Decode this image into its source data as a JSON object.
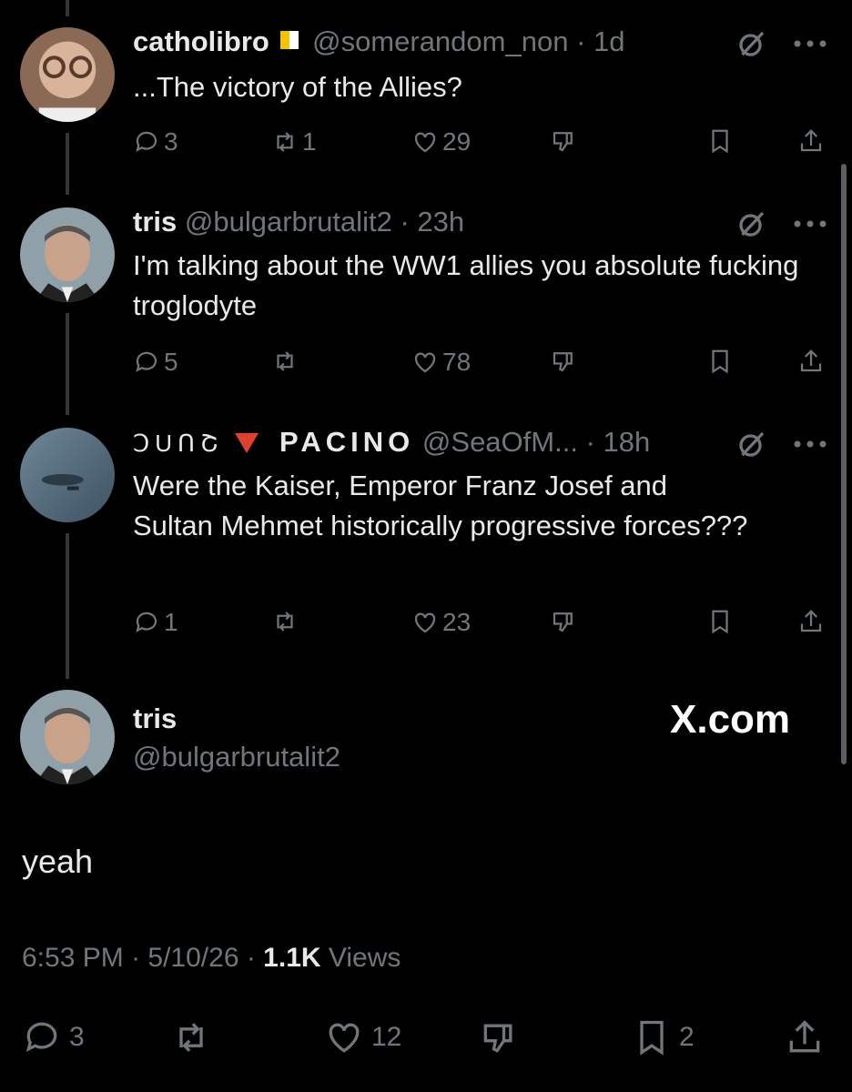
{
  "tweets": [
    {
      "name": "catholibro",
      "handle": "@somerandom_non",
      "time": "· 1d",
      "text": "...The victory of the Allies?",
      "replies": "3",
      "reposts": "1",
      "likes": "29"
    },
    {
      "name": "tris",
      "handle": "@bulgarbrutalit2",
      "time": "· 23h",
      "text": "I'm talking about the WW1 allies you absolute fucking troglodyte",
      "replies": "5",
      "reposts": "",
      "likes": "78"
    },
    {
      "name_prefix": "ↃUՈՇ",
      "name": "PACINO",
      "handle": "@SeaOfM...",
      "time": "· 18h",
      "text": "Were the Kaiser, Emperor Franz Josef and Sultan Mehmet historically progressive forces???",
      "replies": "1",
      "reposts": "",
      "likes": "23"
    }
  ],
  "main": {
    "name": "tris",
    "handle": "@bulgarbrutalit2",
    "watermark": "X.com",
    "text": "yeah",
    "time": "6:53 PM",
    "date": "5/10/26",
    "views_count": "1.1K",
    "views_label": "Views",
    "replies": "3",
    "reposts": "",
    "likes": "12",
    "bookmarks": "2"
  },
  "colors": {
    "background": "#000000",
    "text": "#e7e9ea",
    "muted": "#71767b",
    "line": "#333639"
  },
  "icons": [
    "grok-icon",
    "more-icon",
    "reply-icon",
    "repost-icon",
    "like-icon",
    "dislike-icon",
    "bookmark-icon",
    "share-icon",
    "vatican-flag-icon",
    "red-triangle-icon"
  ]
}
